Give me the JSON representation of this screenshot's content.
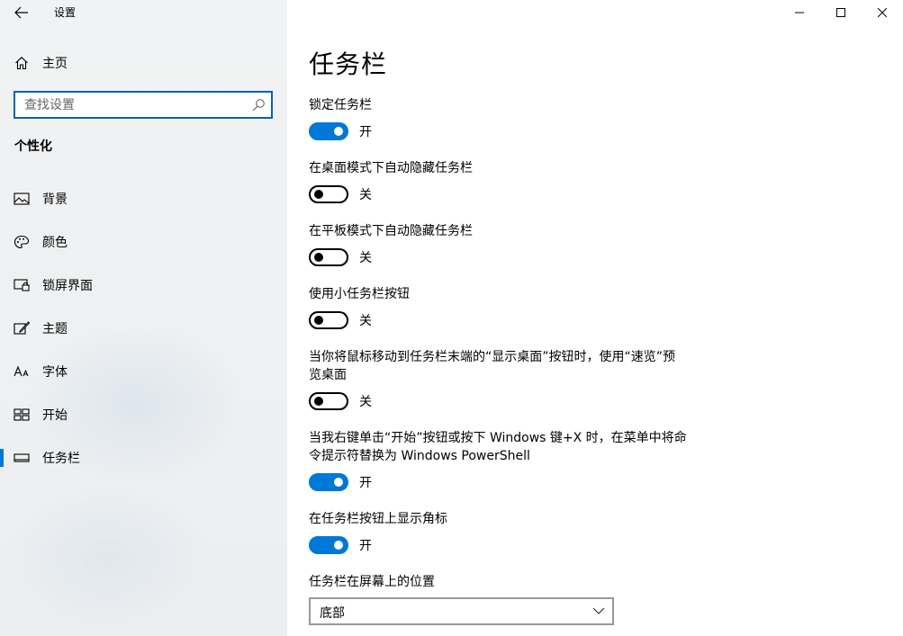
{
  "window": {
    "title": "设置"
  },
  "sidebar": {
    "home_label": "主页",
    "search_placeholder": "查找设置",
    "section_title": "个性化",
    "items": [
      {
        "label": "背景",
        "icon": "picture-icon"
      },
      {
        "label": "颜色",
        "icon": "palette-icon"
      },
      {
        "label": "锁屏界面",
        "icon": "lock-screen-icon"
      },
      {
        "label": "主题",
        "icon": "theme-brush-icon"
      },
      {
        "label": "字体",
        "icon": "font-icon"
      },
      {
        "label": "开始",
        "icon": "start-grid-icon"
      },
      {
        "label": "任务栏",
        "icon": "taskbar-icon",
        "active": true
      }
    ]
  },
  "main": {
    "title": "任务栏",
    "settings": [
      {
        "label": "锁定任务栏",
        "state": "开",
        "on": true
      },
      {
        "label": "在桌面模式下自动隐藏任务栏",
        "state": "关",
        "on": false
      },
      {
        "label": "在平板模式下自动隐藏任务栏",
        "state": "关",
        "on": false
      },
      {
        "label": "使用小任务栏按钮",
        "state": "关",
        "on": false
      },
      {
        "label_line1": "当你将鼠标移动到任务栏末端的“显示桌面”按钮时，使用“速览”预",
        "label_line2": "览桌面",
        "state": "关",
        "on": false
      },
      {
        "label_line1": "当我右键单击“开始”按钮或按下 Windows 键+X 时，在菜单中将命",
        "label_line2": "令提示符替换为 Windows PowerShell",
        "state": "开",
        "on": true
      },
      {
        "label": "在任务栏按钮上显示角标",
        "state": "开",
        "on": true
      }
    ],
    "position_label": "任务栏在屏幕上的位置",
    "position_value": "底部"
  },
  "colors": {
    "accent": "#0078d7",
    "search_border": "#0063b1"
  }
}
